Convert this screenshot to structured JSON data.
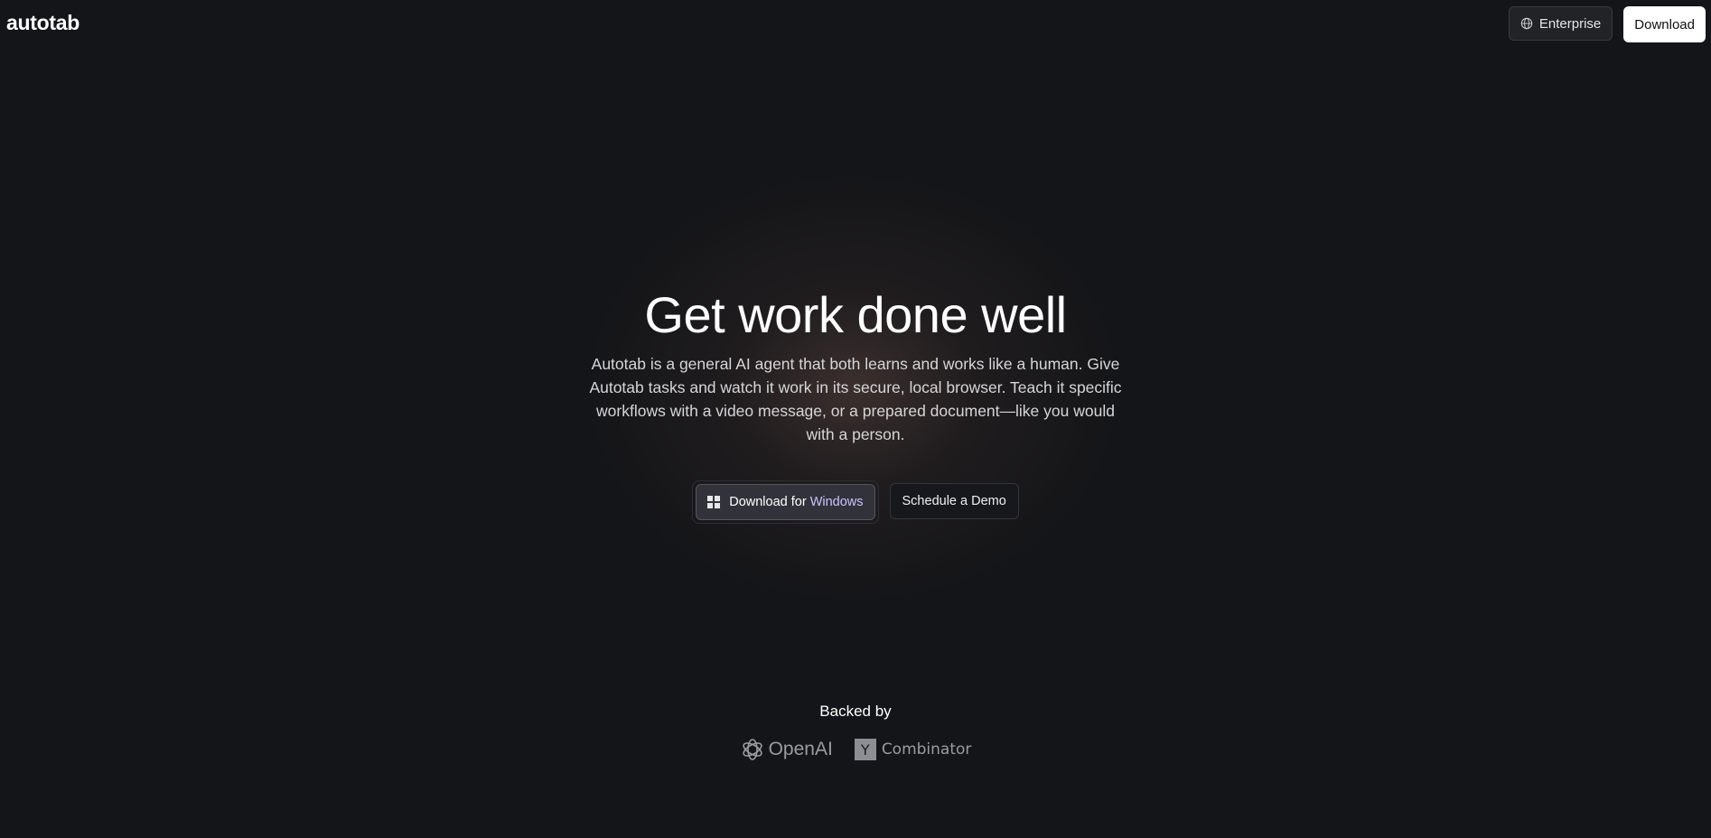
{
  "header": {
    "logo": "autotab",
    "enterprise_label": "Enterprise",
    "download_label": "Download"
  },
  "hero": {
    "headline": "Get work done well",
    "description": "Autotab is a general AI agent that both learns and works like a human. Give Autotab tasks and watch it work in its secure, local browser. Teach it specific workflows with a video message, or a prepared document—like you would with a person.",
    "cta_primary_prefix": "Download for",
    "cta_primary_accent": "Windows",
    "cta_secondary": "Schedule a Demo"
  },
  "backers": {
    "label": "Backed by",
    "items": [
      {
        "name": "OpenAI",
        "icon": "openai-logo-icon"
      },
      {
        "name": "Combinator",
        "mark": "Y",
        "icon": "y-combinator-logo-icon"
      }
    ]
  },
  "colors": {
    "background": "#141518",
    "cta_accent": "#c9c3ff",
    "glow": "#967060"
  }
}
